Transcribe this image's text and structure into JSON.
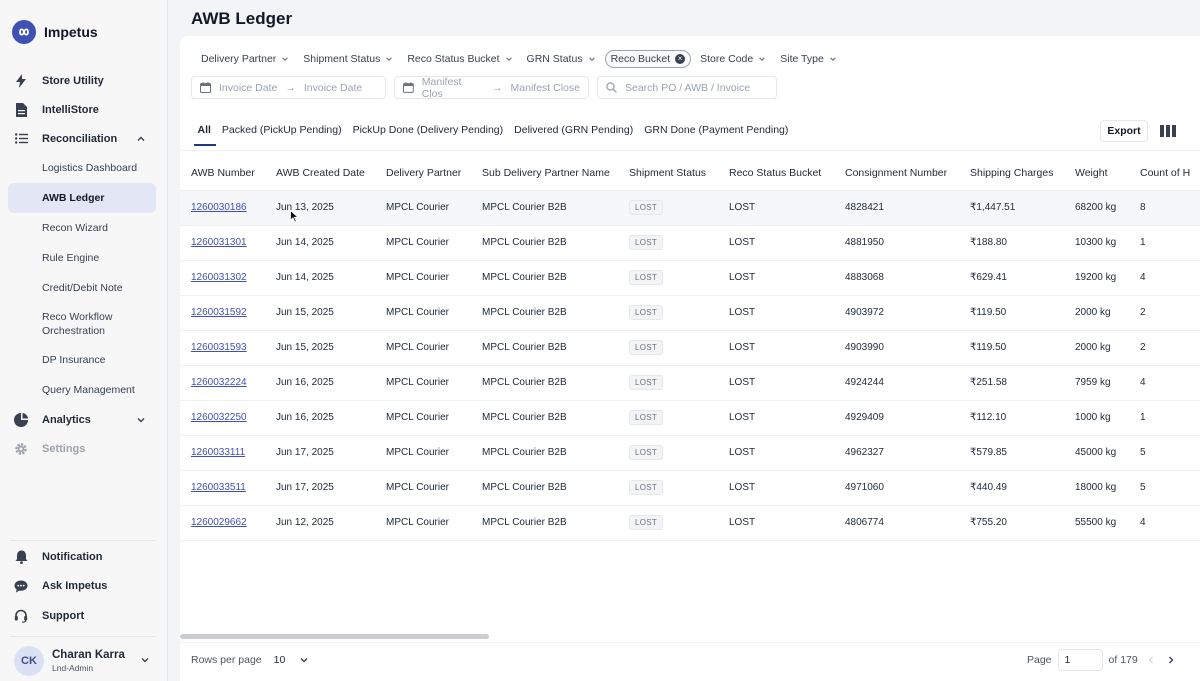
{
  "app": {
    "name": "Impetus"
  },
  "sidebar": {
    "items": [
      {
        "label": "Store Utility",
        "icon": "bolt-icon"
      },
      {
        "label": "IntelliStore",
        "icon": "document-icon"
      },
      {
        "label": "Reconciliation",
        "icon": "list-icon",
        "expanded": true
      }
    ],
    "recon_sub": [
      {
        "label": "Logistics Dashboard"
      },
      {
        "label": "AWB Ledger",
        "active": true
      },
      {
        "label": "Recon Wizard"
      },
      {
        "label": "Rule Engine"
      },
      {
        "label": "Credit/Debit Note"
      },
      {
        "label": "Reco Workflow Orchestration"
      },
      {
        "label": "DP Insurance"
      },
      {
        "label": "Query Management"
      }
    ],
    "analytics": {
      "label": "Analytics"
    },
    "settings": {
      "label": "Settings"
    },
    "bottom": [
      {
        "label": "Notification",
        "icon": "bell-icon"
      },
      {
        "label": "Ask Impetus",
        "icon": "chat-icon"
      },
      {
        "label": "Support",
        "icon": "headset-icon"
      }
    ],
    "user": {
      "initials": "CK",
      "name": "Charan Karra",
      "role": "Lnd-Admin"
    }
  },
  "page": {
    "title": "AWB Ledger"
  },
  "filters": {
    "dropdowns": [
      "Delivery Partner",
      "Shipment Status",
      "Reco Status Bucket",
      "GRN Status"
    ],
    "active_pill": "Reco Bucket",
    "dropdowns_after": [
      "Store Code",
      "Site Type"
    ],
    "invoice_from": "Invoice Date",
    "invoice_to": "Invoice Date",
    "manifest_from": "Manifest Clos",
    "manifest_to": "Manifest Close",
    "search_placeholder": "Search PO / AWB / Invoice"
  },
  "tabs": [
    {
      "label": "All",
      "active": true
    },
    {
      "label": "Packed (PickUp Pending)"
    },
    {
      "label": "PickUp Done (Delivery Pending)"
    },
    {
      "label": "Delivered (GRN Pending)"
    },
    {
      "label": "GRN Done (Payment Pending)"
    }
  ],
  "toolbar": {
    "export_label": "Export"
  },
  "table": {
    "columns": [
      "AWB Number",
      "AWB Created Date",
      "Delivery Partner",
      "Sub Delivery Partner Name",
      "Shipment Status",
      "Reco Status Bucket",
      "Consignment Number",
      "Shipping Charges",
      "Weight",
      "Count of H"
    ],
    "rows": [
      [
        "1260030186",
        "Jun 13, 2025",
        "MPCL Courier",
        "MPCL Courier B2B",
        "LOST",
        "LOST",
        "4828421",
        "₹1,447.51",
        "68200 kg",
        "8"
      ],
      [
        "1260031301",
        "Jun 14, 2025",
        "MPCL Courier",
        "MPCL Courier B2B",
        "LOST",
        "LOST",
        "4881950",
        "₹188.80",
        "10300 kg",
        "1"
      ],
      [
        "1260031302",
        "Jun 14, 2025",
        "MPCL Courier",
        "MPCL Courier B2B",
        "LOST",
        "LOST",
        "4883068",
        "₹629.41",
        "19200 kg",
        "4"
      ],
      [
        "1260031592",
        "Jun 15, 2025",
        "MPCL Courier",
        "MPCL Courier B2B",
        "LOST",
        "LOST",
        "4903972",
        "₹119.50",
        "2000 kg",
        "2"
      ],
      [
        "1260031593",
        "Jun 15, 2025",
        "MPCL Courier",
        "MPCL Courier B2B",
        "LOST",
        "LOST",
        "4903990",
        "₹119.50",
        "2000 kg",
        "2"
      ],
      [
        "1260032224",
        "Jun 16, 2025",
        "MPCL Courier",
        "MPCL Courier B2B",
        "LOST",
        "LOST",
        "4924244",
        "₹251.58",
        "7959 kg",
        "4"
      ],
      [
        "1260032250",
        "Jun 16, 2025",
        "MPCL Courier",
        "MPCL Courier B2B",
        "LOST",
        "LOST",
        "4929409",
        "₹112.10",
        "1000 kg",
        "1"
      ],
      [
        "1260033111",
        "Jun 17, 2025",
        "MPCL Courier",
        "MPCL Courier B2B",
        "LOST",
        "LOST",
        "4962327",
        "₹579.85",
        "45000 kg",
        "5"
      ],
      [
        "1260033511",
        "Jun 17, 2025",
        "MPCL Courier",
        "MPCL Courier B2B",
        "LOST",
        "LOST",
        "4971060",
        "₹440.49",
        "18000 kg",
        "5"
      ],
      [
        "1260029662",
        "Jun 12, 2025",
        "MPCL Courier",
        "MPCL Courier B2B",
        "LOST",
        "LOST",
        "4806774",
        "₹755.20",
        "55500 kg",
        "4"
      ]
    ]
  },
  "pagination": {
    "rows_per_page_label": "Rows per page",
    "rows_per_page": "10",
    "page_label": "Page",
    "page_value": "1",
    "of_label": "of 179"
  },
  "colors": {
    "brand": "#3f51b5",
    "active_bg": "#e3e6f4",
    "link": "#3f51b5"
  }
}
